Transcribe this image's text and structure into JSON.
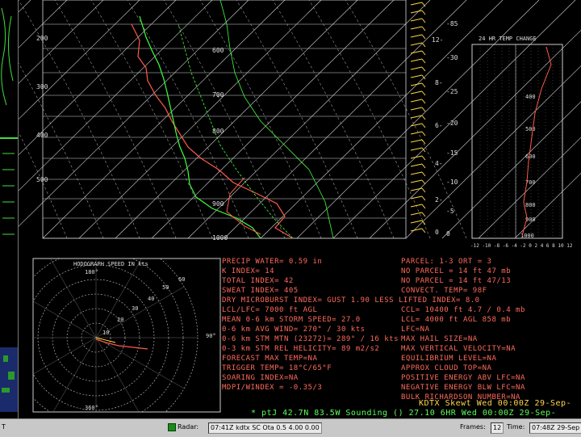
{
  "skewt": {
    "pressure_labels": [
      "200",
      "300",
      "400",
      "500",
      "600",
      "700",
      "800",
      "900",
      "1000"
    ],
    "height_labels": [
      "12-",
      "8-",
      "6-",
      "4-",
      "2-",
      "0"
    ],
    "temp_labels": [
      "-85",
      "-30",
      "-25",
      "-20",
      "-15",
      "-10",
      "-5",
      "0"
    ]
  },
  "hodograph": {
    "title": "HODOGRAPH SPEED IN kts",
    "ring_labels": [
      "10",
      "20",
      "30",
      "40",
      "50",
      "60"
    ],
    "dir_labels": [
      "180°",
      "90°",
      "360°"
    ]
  },
  "temp_change": {
    "title": "24 HR TEMP CHANGE",
    "y_labels": [
      "400",
      "500",
      "600",
      "700",
      "800",
      "900",
      "1000"
    ],
    "x_labels": "-12 -10 -8 -6 -4 -2 0 2 4 6 8 10 12"
  },
  "stats_left": [
    "PRECIP WATER= 0.59 in",
    "K INDEX= 14",
    "TOTAL INDEX= 42",
    "SWEAT INDEX= 405",
    "DRY MICROBURST INDEX= GUST 1.90 LESS LIFTED INDEX= 8.0",
    "LCL/LFC= 7000 ft AGL",
    "MEAN 0-6 km STORM SPEED= 27.0",
    "0-6 km AVG WIND= 270° / 30 kts",
    "0-6 km STM MTN (23272)= 289° / 16 kts",
    "0-3 km STM REL HELICITY= 89 m2/s2",
    "FORECAST MAX TEMP=NA",
    "TRIGGER TEMP= 18°C/65°F",
    "SOARING INDEX=NA",
    "MDPI/WINDEX = -0.35/3"
  ],
  "stats_right": [
    "PARCEL: 1-3 ORT = 3",
    "NO PARCEL = 14 ft 47 mb",
    "NO PARCEL = 14 ft 47/13",
    "CONVECT. TEMP= 98F",
    "CCL= 10400 ft 4.7 / 0.4 mb",
    "LCL= 4000 ft AGL 858 mb",
    "LFC=NA",
    "MAX HAIL SIZE=NA",
    "MAX VERTICAL VELOCITY=NA",
    "EQUILIBRIUM LEVEL=NA",
    "APPROX CLOUD TOP=NA",
    "POSITIVE ENERGY ABV LFC=NA",
    "NEGATIVE ENERGY BLW LFC=NA",
    "BULK RICHARDSON NUMBER=NA"
  ],
  "title_line": "KDTX Skewt Wed 00:00Z 29-Sep-",
  "sounding_line": "* ptJ 42.7N 83.5W Sounding () 27.10 6HR Wed 00:00Z 29-Sep-",
  "statusbar": {
    "left_label": "T",
    "radar_label": "Radar:",
    "radar_value": "07:41Z kdtx SC Ota 0.5 4.00 0.00",
    "frames_label": "Frames:",
    "frames_value": "12",
    "time_label": "Time:",
    "time_value": "07:48Z 29-Sep"
  },
  "colors": {
    "temperature": "#ff5a4a",
    "dewpoint": "#40ff40",
    "grid": "#d8d8d8",
    "wind": "#ffd840"
  }
}
